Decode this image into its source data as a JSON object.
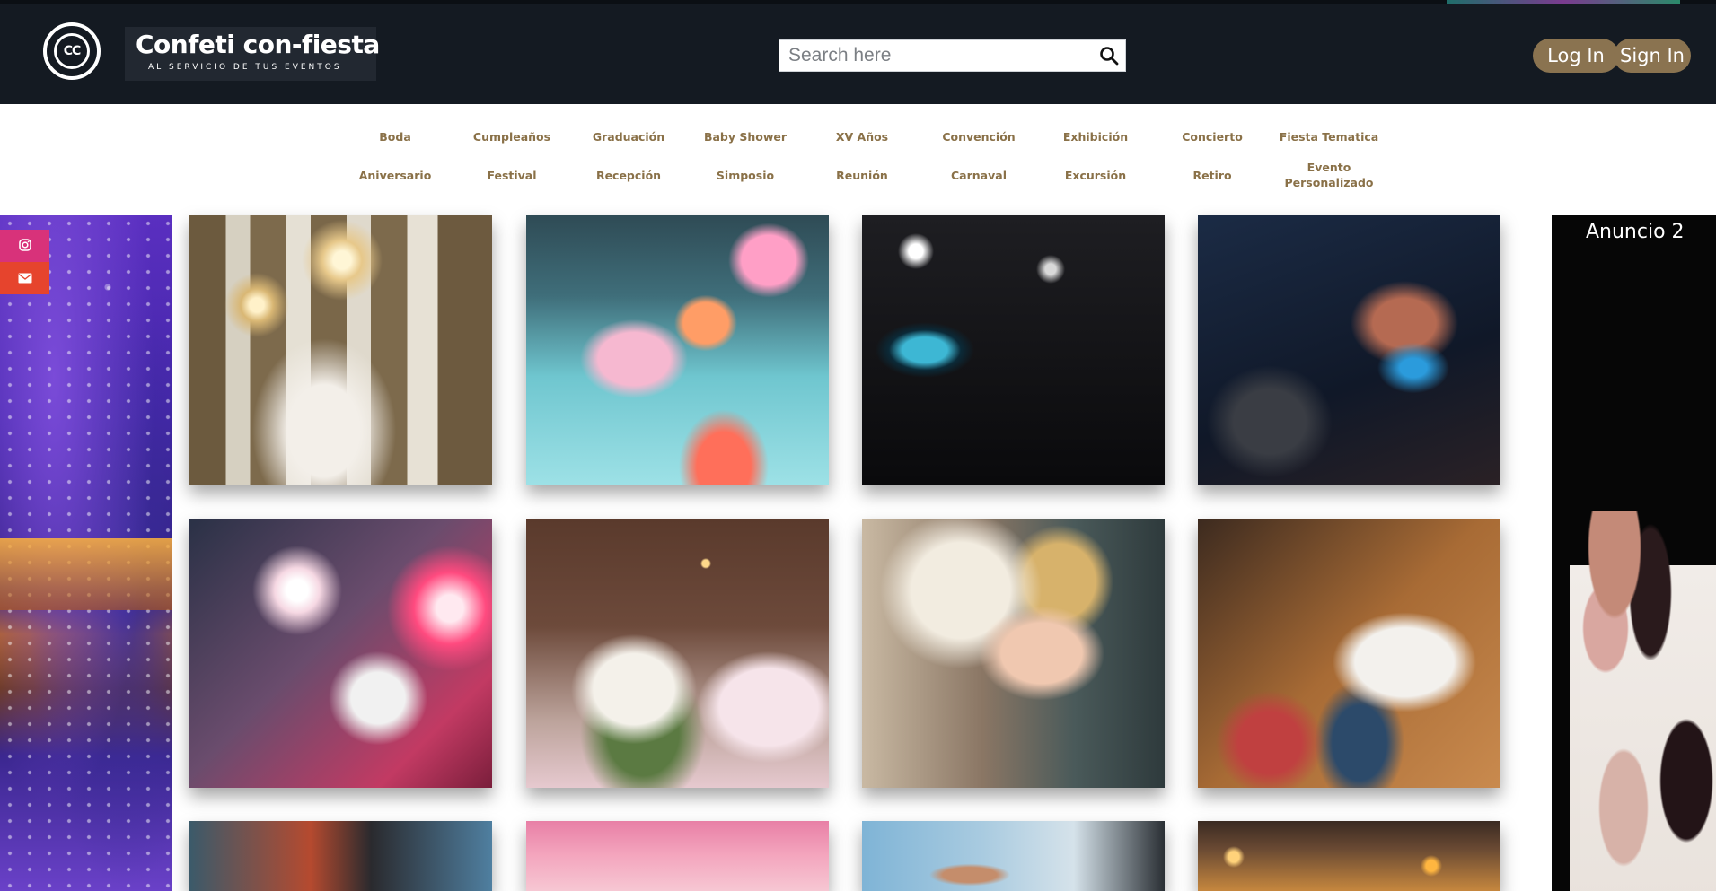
{
  "header": {
    "logo_text": "CC",
    "brand_title": "Confeti con-fiesta",
    "brand_subtitle": "AL SERVICIO DE TUS EVENTOS",
    "search_placeholder": "Search here",
    "search_icon": "search-icon",
    "login_label": "Log In",
    "signin_label": "Sign In"
  },
  "categories": {
    "row1": [
      "Boda",
      "Cumpleaños",
      "Graduación",
      "Baby Shower",
      "XV Años",
      "Convención",
      "Exhibición",
      "Concierto",
      "Fiesta Tematica"
    ],
    "row2": [
      "Aniversario",
      "Festival",
      "Recepción",
      "Simposio",
      "Reunión",
      "Carnaval",
      "Excursión",
      "Retiro",
      "Evento Personalizado"
    ]
  },
  "social": {
    "instagram_icon": "instagram-icon",
    "email_icon": "envelope-icon"
  },
  "ad": {
    "title": "Anuncio 2"
  },
  "colors": {
    "header_bg": "#141a22",
    "accent_gold": "#8a7350",
    "category_text": "#8a7148",
    "instagram": "#d8327a",
    "email": "#e6442d"
  }
}
